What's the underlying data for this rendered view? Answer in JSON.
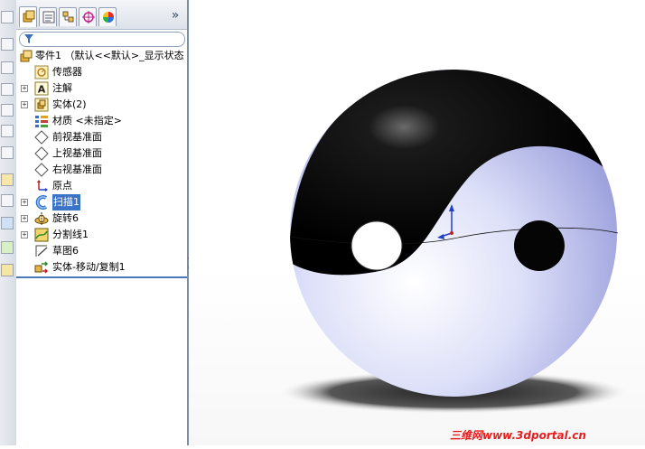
{
  "feature_tree": {
    "root": {
      "label": "零件1 （默认<<默认>_显示状态"
    },
    "items": [
      {
        "label": "传感器",
        "icon": "sensor-icon",
        "expandable": false,
        "selected": false
      },
      {
        "label": "注解",
        "icon": "annotation-icon",
        "expandable": true,
        "selected": false
      },
      {
        "label": "实体(2)",
        "icon": "solid-bodies-icon",
        "expandable": true,
        "selected": false
      },
      {
        "label": "材质 <未指定>",
        "icon": "material-icon",
        "expandable": false,
        "selected": false
      },
      {
        "label": "前视基准面",
        "icon": "plane-icon",
        "expandable": false,
        "selected": false
      },
      {
        "label": "上视基准面",
        "icon": "plane-icon",
        "expandable": false,
        "selected": false
      },
      {
        "label": "右视基准面",
        "icon": "plane-icon",
        "expandable": false,
        "selected": false
      },
      {
        "label": "原点",
        "icon": "origin-icon",
        "expandable": false,
        "selected": false
      },
      {
        "label": "扫描1",
        "icon": "sweep-icon",
        "expandable": true,
        "selected": true
      },
      {
        "label": "旋转6",
        "icon": "revolve-icon",
        "expandable": true,
        "selected": false
      },
      {
        "label": "分割线1",
        "icon": "split-line-icon",
        "expandable": true,
        "selected": false
      },
      {
        "label": "草图6",
        "icon": "sketch-icon",
        "expandable": false,
        "selected": false
      },
      {
        "label": "实体-移动/复制1",
        "icon": "move-copy-body-icon",
        "expandable": false,
        "selected": false
      }
    ]
  },
  "tabs": [
    {
      "icon": "feature-manager-icon"
    },
    {
      "icon": "property-manager-icon"
    },
    {
      "icon": "configuration-manager-icon"
    },
    {
      "icon": "dimxpert-icon"
    },
    {
      "icon": "display-manager-icon"
    }
  ],
  "watermark": "三维网www.3dportal.cn",
  "colors": {
    "selection": "#3b74c7",
    "sphere_light": "#dcdff8",
    "sphere_dark": "#000000",
    "watermark": "#e81e1e"
  }
}
